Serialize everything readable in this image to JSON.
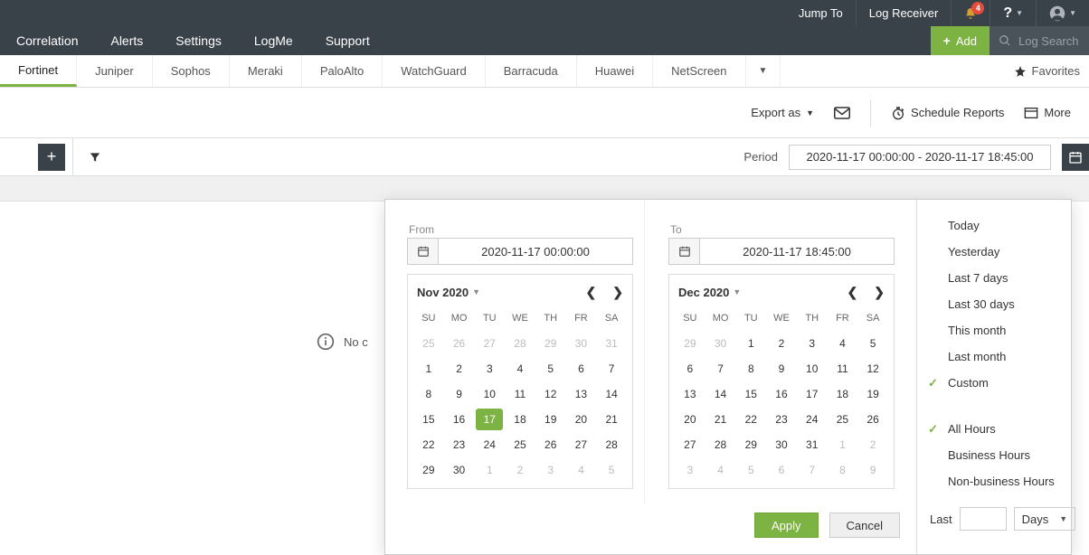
{
  "topbar": {
    "jump_to": "Jump To",
    "log_receiver": "Log Receiver",
    "notif_count": "4",
    "help": "?"
  },
  "nav": {
    "items": [
      "Correlation",
      "Alerts",
      "Settings",
      "LogMe",
      "Support"
    ],
    "add": "Add",
    "search_placeholder": "Log Search"
  },
  "tabs": {
    "items": [
      "Fortinet",
      "Juniper",
      "Sophos",
      "Meraki",
      "PaloAlto",
      "WatchGuard",
      "Barracuda",
      "Huawei",
      "NetScreen"
    ],
    "favorites": "Favorites"
  },
  "actions": {
    "export": "Export as",
    "schedule": "Schedule Reports",
    "more": "More"
  },
  "toolbar": {
    "period_label": "Period",
    "period_value": "2020-11-17 00:00:00 - 2020-11-17 18:45:00"
  },
  "nodata": "No c",
  "picker": {
    "from_label": "From",
    "to_label": "To",
    "from_value": "2020-11-17 00:00:00",
    "to_value": "2020-11-17 18:45:00",
    "apply": "Apply",
    "cancel": "Cancel",
    "cal1": {
      "title": "Nov 2020",
      "dow": [
        "SU",
        "MO",
        "TU",
        "WE",
        "TH",
        "FR",
        "SA"
      ],
      "days": [
        {
          "d": "25",
          "o": true
        },
        {
          "d": "26",
          "o": true
        },
        {
          "d": "27",
          "o": true
        },
        {
          "d": "28",
          "o": true
        },
        {
          "d": "29",
          "o": true
        },
        {
          "d": "30",
          "o": true
        },
        {
          "d": "31",
          "o": true
        },
        {
          "d": "1"
        },
        {
          "d": "2"
        },
        {
          "d": "3"
        },
        {
          "d": "4"
        },
        {
          "d": "5"
        },
        {
          "d": "6"
        },
        {
          "d": "7"
        },
        {
          "d": "8"
        },
        {
          "d": "9"
        },
        {
          "d": "10"
        },
        {
          "d": "11"
        },
        {
          "d": "12"
        },
        {
          "d": "13"
        },
        {
          "d": "14"
        },
        {
          "d": "15"
        },
        {
          "d": "16"
        },
        {
          "d": "17",
          "sel": true
        },
        {
          "d": "18"
        },
        {
          "d": "19"
        },
        {
          "d": "20"
        },
        {
          "d": "21"
        },
        {
          "d": "22"
        },
        {
          "d": "23"
        },
        {
          "d": "24"
        },
        {
          "d": "25"
        },
        {
          "d": "26"
        },
        {
          "d": "27"
        },
        {
          "d": "28"
        },
        {
          "d": "29"
        },
        {
          "d": "30"
        },
        {
          "d": "1",
          "o": true
        },
        {
          "d": "2",
          "o": true
        },
        {
          "d": "3",
          "o": true
        },
        {
          "d": "4",
          "o": true
        },
        {
          "d": "5",
          "o": true
        }
      ]
    },
    "cal2": {
      "title": "Dec 2020",
      "dow": [
        "SU",
        "MO",
        "TU",
        "WE",
        "TH",
        "FR",
        "SA"
      ],
      "days": [
        {
          "d": "29",
          "o": true
        },
        {
          "d": "30",
          "o": true
        },
        {
          "d": "1"
        },
        {
          "d": "2"
        },
        {
          "d": "3"
        },
        {
          "d": "4"
        },
        {
          "d": "5"
        },
        {
          "d": "6"
        },
        {
          "d": "7"
        },
        {
          "d": "8"
        },
        {
          "d": "9"
        },
        {
          "d": "10"
        },
        {
          "d": "11"
        },
        {
          "d": "12"
        },
        {
          "d": "13"
        },
        {
          "d": "14"
        },
        {
          "d": "15"
        },
        {
          "d": "16"
        },
        {
          "d": "17"
        },
        {
          "d": "18"
        },
        {
          "d": "19"
        },
        {
          "d": "20"
        },
        {
          "d": "21"
        },
        {
          "d": "22"
        },
        {
          "d": "23"
        },
        {
          "d": "24"
        },
        {
          "d": "25"
        },
        {
          "d": "26"
        },
        {
          "d": "27"
        },
        {
          "d": "28"
        },
        {
          "d": "29"
        },
        {
          "d": "30"
        },
        {
          "d": "31"
        },
        {
          "d": "1",
          "o": true
        },
        {
          "d": "2",
          "o": true
        },
        {
          "d": "3",
          "o": true
        },
        {
          "d": "4",
          "o": true
        },
        {
          "d": "5",
          "o": true
        },
        {
          "d": "6",
          "o": true
        },
        {
          "d": "7",
          "o": true
        },
        {
          "d": "8",
          "o": true
        },
        {
          "d": "9",
          "o": true
        }
      ]
    },
    "presets": [
      "Today",
      "Yesterday",
      "Last 7 days",
      "Last 30 days",
      "This month",
      "Last month",
      "Custom"
    ],
    "preset_selected": 6,
    "hours": [
      "All Hours",
      "Business Hours",
      "Non-business Hours"
    ],
    "hours_selected": 0,
    "last_label": "Last",
    "last_unit": "Days"
  }
}
